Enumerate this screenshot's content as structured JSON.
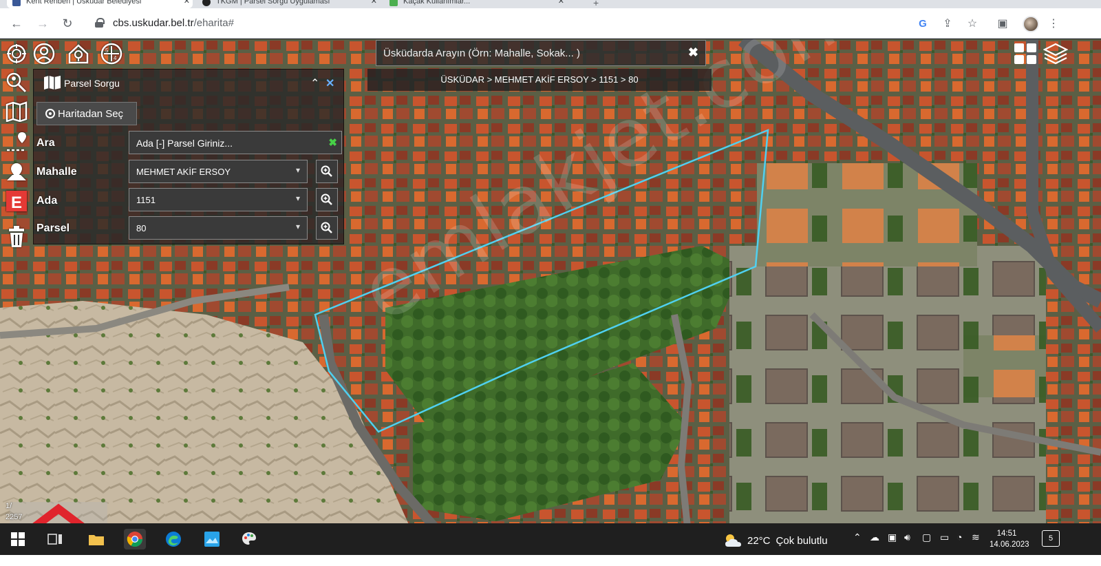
{
  "browser": {
    "tabs": [
      {
        "title": "Kent Rehberi | Üsküdar Belediyesi"
      },
      {
        "title": "TKGM | Parsel Sorgu Uygulaması"
      },
      {
        "title": "Kaçak Kullanımlar..."
      }
    ],
    "url_host": "cbs.uskudar.bel.tr",
    "url_path": "/eharita#"
  },
  "map": {
    "search_placeholder": "Üsküdarda Arayın (Örn: Mahalle, Sokak... )",
    "breadcrumb": "ÜSKÜDAR > MEHMET AKİF ERSOY > 1151 > 80",
    "watermark": "emlakjet.com",
    "scale_top": "1/",
    "scale_bottom": "2257",
    "parcel_outline_color": "#4fd0f0"
  },
  "panel": {
    "title": "Parsel Sorgu",
    "pick_label": "Haritadan Seç",
    "search_label": "Ara",
    "search_placeholder": "Ada [-] Parsel Giriniz...",
    "mahalle_label": "Mahalle",
    "mahalle_value": "MEHMET AKİF ERSOY",
    "ada_label": "Ada",
    "ada_value": "1151",
    "parsel_label": "Parsel",
    "parsel_value": "80"
  },
  "taskbar": {
    "temperature": "22°C",
    "weather": "Çok bulutlu",
    "time": "14:51",
    "date": "14.06.2023",
    "notification_count": "5"
  }
}
